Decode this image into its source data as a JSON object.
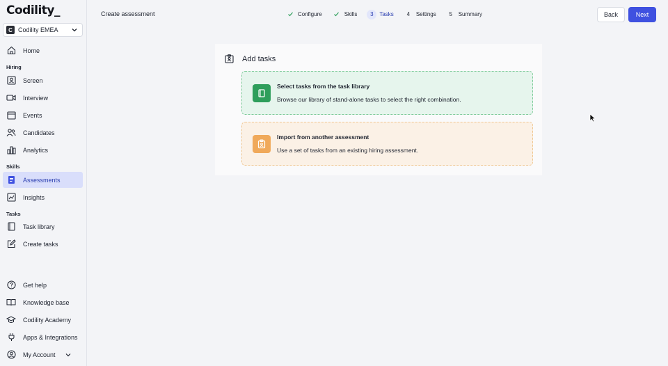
{
  "logo": "Codility_",
  "org": {
    "badge": "C",
    "name": "Codility EMEA"
  },
  "nav": {
    "home": "Home",
    "hiring_section": "Hiring",
    "screen": "Screen",
    "interview": "Interview",
    "events": "Events",
    "candidates": "Candidates",
    "analytics": "Analytics",
    "skills_section": "Skills",
    "assessments": "Assessments",
    "insights": "Insights",
    "tasks_section": "Tasks",
    "task_library": "Task library",
    "create_tasks": "Create tasks",
    "get_help": "Get help",
    "knowledge_base": "Knowledge base",
    "academy": "Codility Academy",
    "apps": "Apps & Integrations",
    "account": "My Account"
  },
  "header": {
    "breadcrumb": "Create assessment",
    "back": "Back",
    "next": "Next"
  },
  "steps": [
    {
      "marker": "✓",
      "label": "Configure",
      "state": "done"
    },
    {
      "marker": "✓",
      "label": "Skills",
      "state": "done"
    },
    {
      "marker": "3",
      "label": "Tasks",
      "state": "current"
    },
    {
      "marker": "4",
      "label": "Settings",
      "state": "todo"
    },
    {
      "marker": "5",
      "label": "Summary",
      "state": "todo"
    }
  ],
  "panel": {
    "title": "Add tasks",
    "library_card": {
      "title": "Select tasks from the task library",
      "desc": "Browse our library of stand-alone tasks to select the right combination."
    },
    "import_card": {
      "title": "Import from another assessment",
      "desc": "Use a set of tasks from an existing hiring assessment."
    }
  },
  "colors": {
    "accent": "#3f51e0",
    "active_nav_bg": "#d9defb",
    "library_green": "#2e9e5b",
    "import_orange": "#f0a95a",
    "step_done": "#2e9e5b"
  }
}
